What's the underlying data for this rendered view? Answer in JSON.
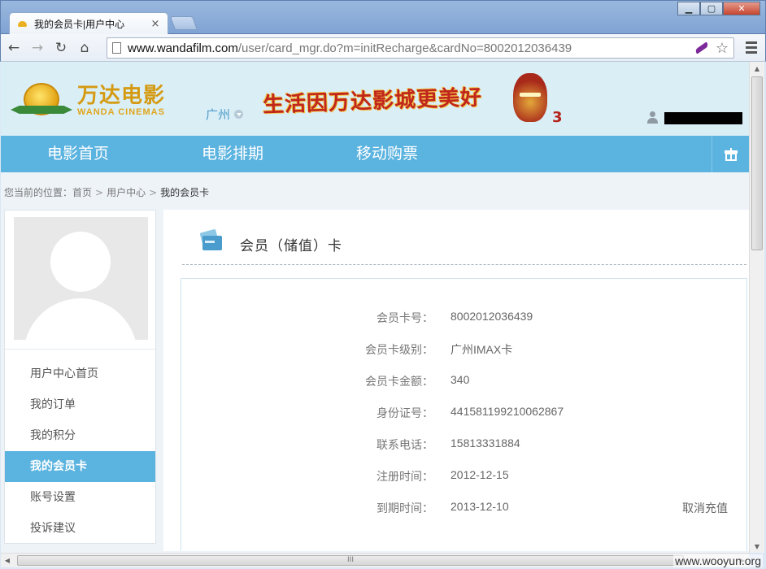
{
  "browser": {
    "tab_title": "我的会员卡|用户中心",
    "tab_close": "×",
    "url_host": "www.wandafilm.com",
    "url_path": "/user/card_mgr.do?m=initRecharge&cardNo=8002012036439",
    "back": "←",
    "forward": "→",
    "reload": "↻",
    "home": "⌂",
    "star": "☆",
    "minimize": "▁",
    "maximize": "▢",
    "close": "✕"
  },
  "header": {
    "logo_cn": "万达电影",
    "logo_en": "WANDA CINEMAS",
    "city": "广州",
    "banner_text": "生活因万达影城更美好",
    "banner_number": "3"
  },
  "nav": {
    "items": [
      "电影首页",
      "电影排期",
      "移动购票"
    ]
  },
  "breadcrumb": {
    "prefix": "您当前的位置：",
    "home": "首页",
    "sep": ">",
    "user_center": "用户中心",
    "current": "我的会员卡"
  },
  "sidebar": {
    "items": [
      "用户中心首页",
      "我的订单",
      "我的积分",
      "我的会员卡",
      "账号设置",
      "投诉建议"
    ],
    "active_index": 3
  },
  "main": {
    "title": "会员（储值）卡",
    "rows": [
      {
        "label": "会员卡号：",
        "value": "8002012036439"
      },
      {
        "label": "会员卡级别：",
        "value": "广州IMAX卡"
      },
      {
        "label": "会员卡金额：",
        "value": "340"
      },
      {
        "label": "身份证号：",
        "value": "441581199210062867"
      },
      {
        "label": "联系电话：",
        "value": "15813331884"
      },
      {
        "label": "注册时间：",
        "value": "2012-12-15"
      },
      {
        "label": "到期时间：",
        "value": "2013-12-10"
      }
    ],
    "cancel_recharge": "取消充值"
  },
  "scroll": {
    "h_grip": "III",
    "up": "▲",
    "down": "▼",
    "left": "◀",
    "right": "▶"
  },
  "watermark": "www.wooyun.org",
  "colors": {
    "accent": "#5bb3df",
    "header_bg": "#daeef6",
    "brand_gold": "#d49a12"
  }
}
